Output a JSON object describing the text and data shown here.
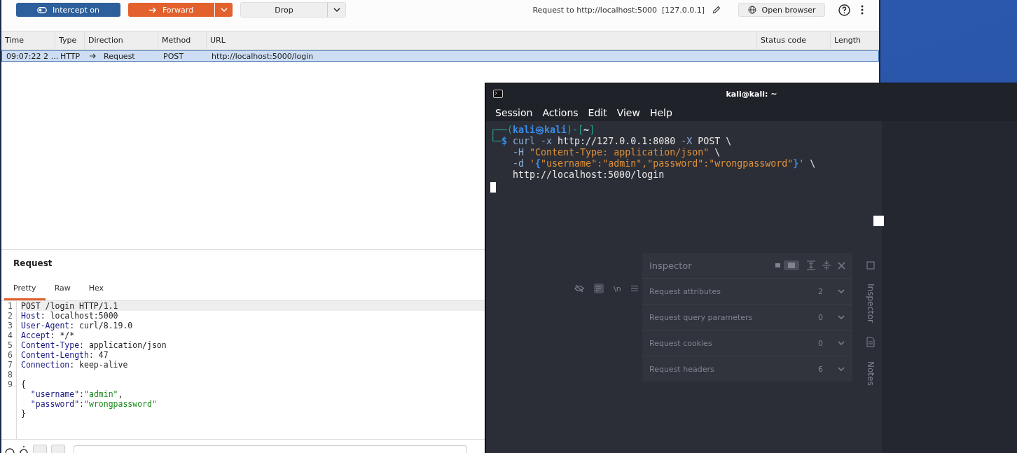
{
  "toolbar": {
    "intercept": {
      "label": "Intercept on",
      "on": true
    },
    "forward": {
      "label": "Forward"
    },
    "drop": {
      "label": "Drop"
    },
    "target": "Request to http://localhost:5000  [127.0.0.1]",
    "open_browser": "Open browser"
  },
  "table": {
    "columns": [
      "Time",
      "Type",
      "Direction",
      "Method",
      "URL",
      "Status code",
      "Length"
    ],
    "rows": [
      {
        "selected": true,
        "cells": [
          "09:07:22 2 …",
          "HTTP",
          "Request",
          "POST",
          "http://localhost:5000/login"
        ]
      }
    ]
  },
  "request": {
    "title": "Request",
    "tabs": [
      {
        "label": "Pretty",
        "selected": true
      },
      {
        "label": "Raw",
        "selected": false
      },
      {
        "label": "Hex",
        "selected": false
      }
    ],
    "newline_toggle": "\\n",
    "lines": [
      {
        "number": "1",
        "parts": [
          {
            "kind": "plain",
            "text": "POST /login HTTP/1.1"
          }
        ]
      },
      {
        "number": "2",
        "parts": [
          {
            "kind": "key",
            "text": "Host"
          },
          {
            "kind": "plain",
            "text": ": localhost:5000"
          }
        ]
      },
      {
        "number": "3",
        "parts": [
          {
            "kind": "key",
            "text": "User-Agent"
          },
          {
            "kind": "plain",
            "text": ": curl/8.19.0"
          }
        ]
      },
      {
        "number": "4",
        "parts": [
          {
            "kind": "key",
            "text": "Accept"
          },
          {
            "kind": "plain",
            "text": ": */*"
          }
        ]
      },
      {
        "number": "5",
        "parts": [
          {
            "kind": "key",
            "text": "Content-Type"
          },
          {
            "kind": "plain",
            "text": ": application/json"
          }
        ]
      },
      {
        "number": "6",
        "parts": [
          {
            "kind": "key",
            "text": "Content-Length"
          },
          {
            "kind": "plain",
            "text": ": 47"
          }
        ]
      },
      {
        "number": "7",
        "parts": [
          {
            "kind": "key",
            "text": "Connection"
          },
          {
            "kind": "plain",
            "text": ": keep-alive"
          }
        ]
      },
      {
        "number": "8"
      },
      {
        "number": "9",
        "parts": [
          {
            "kind": "plain",
            "text": "{"
          }
        ]
      },
      {
        "parts": [
          {
            "kind": "key",
            "text": "  \"username\""
          },
          {
            "kind": "plain",
            "text": ":"
          },
          {
            "kind": "string",
            "text": "\"admin\""
          },
          {
            "kind": "plain",
            "text": ","
          }
        ]
      },
      {
        "parts": [
          {
            "kind": "key",
            "text": "  \"password\""
          },
          {
            "kind": "plain",
            "text": ":"
          },
          {
            "kind": "string",
            "text": "\"wrongpassword\""
          }
        ]
      },
      {
        "parts": [
          {
            "kind": "plain",
            "text": "}"
          }
        ]
      }
    ]
  },
  "inspector": {
    "title": "Inspector",
    "sections": [
      {
        "label": "Request attributes",
        "count": "2"
      },
      {
        "label": "Request query parameters",
        "count": "0"
      },
      {
        "label": "Request cookies",
        "count": "0"
      },
      {
        "label": "Request headers",
        "count": "6"
      }
    ],
    "side_tabs": [
      "Inspector",
      "Notes"
    ]
  },
  "terminal": {
    "title": "kali@kali: ~",
    "menu": [
      "Session",
      "Actions",
      "Edit",
      "View",
      "Help"
    ],
    "lines": [
      [
        {
          "kind": "frame",
          "text": "┌──("
        },
        {
          "kind": "host",
          "text": "kali㉿kali"
        },
        {
          "kind": "frame",
          "text": ")-["
        },
        {
          "kind": "path",
          "text": "~"
        },
        {
          "kind": "frame",
          "text": "]"
        }
      ],
      [
        {
          "kind": "frame",
          "text": "└─"
        },
        {
          "kind": "host",
          "text": "$"
        },
        {
          "kind": "option",
          "text": " curl -x"
        },
        {
          "kind": "plain",
          "text": " http://127.0.0.1:8080 "
        },
        {
          "kind": "option",
          "text": "-X"
        },
        {
          "kind": "plain",
          "text": " POST \\"
        }
      ],
      [
        {
          "kind": "option",
          "text": "    -H"
        },
        {
          "kind": "string",
          "text": " \"Content-Type: application/json\""
        },
        {
          "kind": "plain",
          "text": " \\"
        }
      ],
      [
        {
          "kind": "option",
          "text": "    -d"
        },
        {
          "kind": "string",
          "text": " '"
        },
        {
          "kind": "brace",
          "text": "{"
        },
        {
          "kind": "string",
          "text": "\"username\":\"admin\",\"password\":\"wrongpassword\""
        },
        {
          "kind": "brace",
          "text": "}"
        },
        {
          "kind": "string",
          "text": "'"
        },
        {
          "kind": "plain",
          "text": " \\"
        }
      ],
      [
        {
          "kind": "plain",
          "text": "    http://localhost:5000/login"
        }
      ]
    ]
  }
}
